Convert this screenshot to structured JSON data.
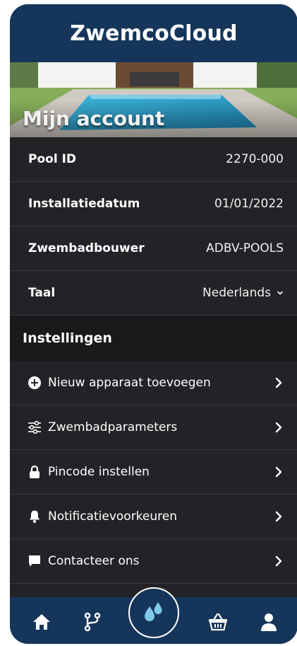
{
  "header": {
    "title": "ZwemcoCloud"
  },
  "hero": {
    "title": "Mijn account"
  },
  "account": [
    {
      "label": "Pool ID",
      "value": "2270-000"
    },
    {
      "label": "Installatiedatum",
      "value": "01/01/2022"
    },
    {
      "label": "Zwembadbouwer",
      "value": "ADBV-POOLS"
    }
  ],
  "language": {
    "label": "Taal",
    "value": "Nederlands"
  },
  "settings": {
    "title": "Instellingen",
    "items": [
      {
        "label": "Nieuw apparaat toevoegen",
        "icon": "plus-circle-icon"
      },
      {
        "label": "Zwembadparameters",
        "icon": "sliders-icon"
      },
      {
        "label": "Pincode instellen",
        "icon": "lock-icon"
      },
      {
        "label": "Notificatievoorkeuren",
        "icon": "bell-icon"
      },
      {
        "label": "Contacteer ons",
        "icon": "chat-icon"
      }
    ]
  },
  "bottom_nav": [
    "home-icon",
    "branch-icon",
    "water-drops-icon",
    "basket-icon",
    "user-icon"
  ],
  "colors": {
    "header": "#15365a",
    "surface": "#232327",
    "section": "#19191b",
    "accent_water": "#7fc8e8"
  }
}
